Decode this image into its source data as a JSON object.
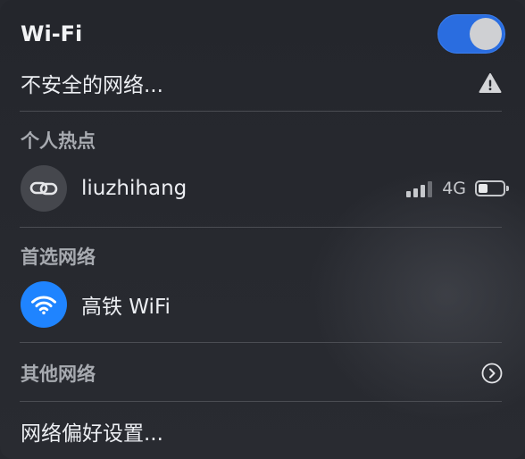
{
  "wifi": {
    "title": "Wi-Fi",
    "enabled": true
  },
  "insecure_network": {
    "label": "不安全的网络...",
    "icon": "warning-icon"
  },
  "hotspot_section": {
    "heading": "个人热点",
    "device": {
      "name": "liuzhihang",
      "icon": "link-icon",
      "signal_bars_filled": 3,
      "signal_bars_total": 4,
      "network_type": "4G",
      "battery_level": 0.4
    }
  },
  "preferred_section": {
    "heading": "首选网络",
    "network": {
      "name": "高铁 WiFi",
      "icon": "wifi-icon"
    }
  },
  "other_networks": {
    "label": "其他网络",
    "icon": "chevron-right-circle-icon"
  },
  "network_preferences": {
    "label": "网络偏好设置..."
  },
  "colors": {
    "accent": "#1f84ff",
    "toggle_on": "#2a6de0",
    "background": "#26282e",
    "section_heading": "#a7aab0"
  }
}
